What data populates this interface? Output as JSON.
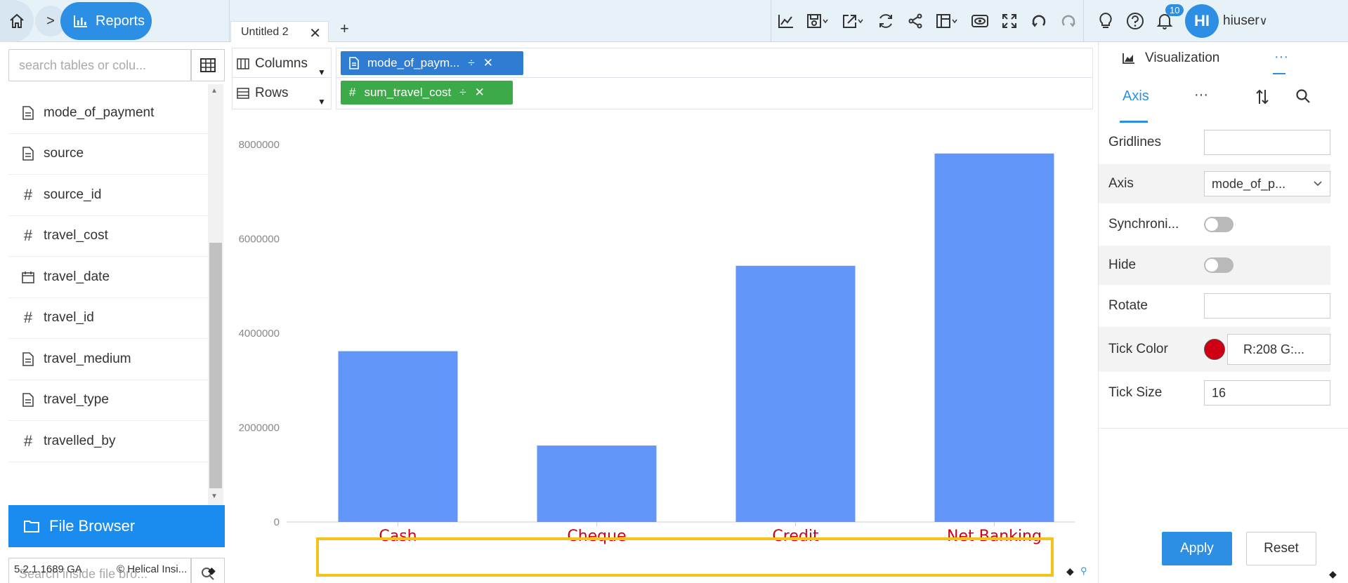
{
  "topbar": {
    "breadcrumb_arrow": ">",
    "reports_label": "Reports",
    "tab_label": "Untitled 2",
    "tab_close": "✕",
    "tab_add": "+",
    "toolbar_icons": [
      "line-chart-icon",
      "save-icon",
      "export-icon",
      "refresh-icon",
      "share-icon",
      "layout-icon",
      "preview-icon",
      "fullscreen-icon",
      "undo-icon",
      "redo-icon"
    ],
    "notifications_count": "10",
    "avatar_initials": "HI",
    "username": "hiuser",
    "username_caret": "∨"
  },
  "left": {
    "search_placeholder": "search tables or colu...",
    "fields": [
      {
        "label": "mode_of_payment",
        "icon": "text-field-icon"
      },
      {
        "label": "source",
        "icon": "text-field-icon"
      },
      {
        "label": "source_id",
        "icon": "number-field-icon"
      },
      {
        "label": "travel_cost",
        "icon": "number-field-icon"
      },
      {
        "label": "travel_date",
        "icon": "date-field-icon"
      },
      {
        "label": "travel_id",
        "icon": "number-field-icon"
      },
      {
        "label": "travel_medium",
        "icon": "text-field-icon"
      },
      {
        "label": "travel_type",
        "icon": "text-field-icon"
      },
      {
        "label": "travelled_by",
        "icon": "number-field-icon"
      }
    ],
    "file_browser_label": "File Browser",
    "file_search_placeholder": "Search inside file bro...",
    "version": "5.2.1.1689 GA",
    "brand": "© Helical Insi..."
  },
  "shelves": {
    "columns_label": "Columns",
    "rows_label": "Rows",
    "column_pill": "mode_of_paym...",
    "row_pill": "sum_travel_cost",
    "pill_divider": "÷",
    "pill_close": "✕",
    "row_pill_hash": "#"
  },
  "chart_data": {
    "type": "bar",
    "categories": [
      "Cash",
      "Cheque",
      "Credit",
      "Net Banking"
    ],
    "values": [
      3620000,
      1620000,
      5430000,
      7810000
    ],
    "ylim": [
      0,
      8000000
    ],
    "yticks": [
      "0",
      "2000000",
      "4000000",
      "6000000",
      "8000000"
    ],
    "bar_color": "#6196f8",
    "tick_color": "#d00014",
    "grid": false
  },
  "right": {
    "visualization_label": "Visualization",
    "more_label": "···",
    "axis_tab": "Axis",
    "axis_more": "···",
    "rows": {
      "gridlines": "Gridlines",
      "axis": "Axis",
      "axis_value": "mode_of_p...",
      "synchronize": "Synchroni...",
      "hide": "Hide",
      "rotate": "Rotate",
      "tick_color": "Tick Color",
      "tick_color_value": "R:208 G:...",
      "tick_size": "Tick Size",
      "tick_size_value": "16"
    },
    "apply_label": "Apply",
    "reset_label": "Reset"
  }
}
